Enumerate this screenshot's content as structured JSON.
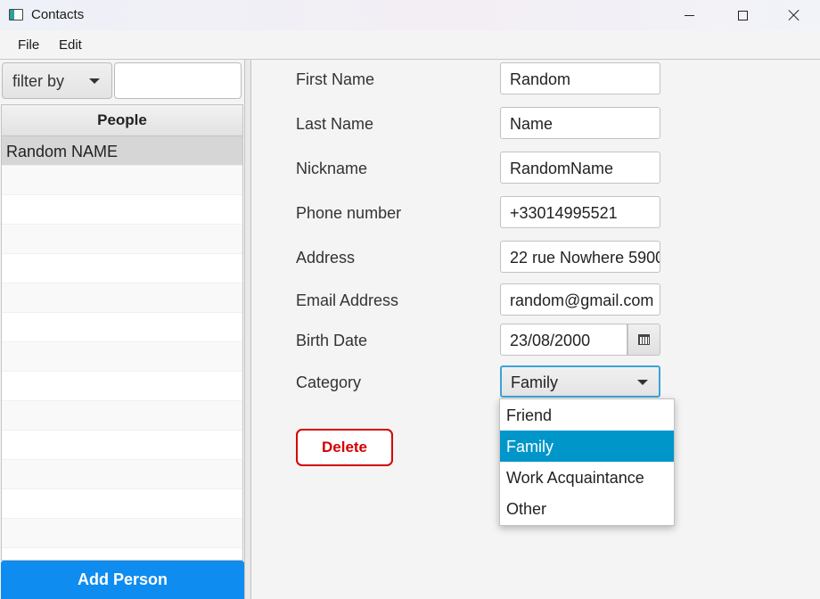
{
  "window": {
    "title": "Contacts"
  },
  "menu": {
    "file": "File",
    "edit": "Edit"
  },
  "sidebar": {
    "filter_selected": "filter by",
    "filter_value": "",
    "table_header": "People",
    "rows": [
      "Random NAME",
      "",
      "",
      "",
      "",
      "",
      "",
      "",
      "",
      "",
      "",
      "",
      "",
      ""
    ],
    "add_button": "Add Person"
  },
  "form": {
    "first_name_label": "First Name",
    "first_name_value": "Random",
    "last_name_label": "Last Name",
    "last_name_value": "Name",
    "nickname_label": "Nickname",
    "nickname_value": "RandomName",
    "phone_label": "Phone number",
    "phone_value": "+33014995521",
    "address_label": "Address",
    "address_value": "22 rue Nowhere 5900",
    "email_label": "Email Address",
    "email_value": "random@gmail.com",
    "birth_label": "Birth Date",
    "birth_value": "23/08/2000",
    "category_label": "Category",
    "category_value": "Family",
    "category_options": [
      "Friend",
      "Family",
      "Work Acquaintance",
      "Other"
    ],
    "category_selected_index": 1,
    "delete_button": "Delete"
  },
  "colors": {
    "accent": "#0f8cf0",
    "selection": "#0096c9",
    "danger": "#d40000",
    "focus": "#3ba4d6"
  },
  "icons": {
    "window": "app-window-icon",
    "minimize": "minimize-icon",
    "maximize": "maximize-icon",
    "close": "close-icon",
    "filter_dropdown": "chevron-down-icon",
    "date_picker": "calendar-icon",
    "category_dropdown": "chevron-down-icon"
  }
}
